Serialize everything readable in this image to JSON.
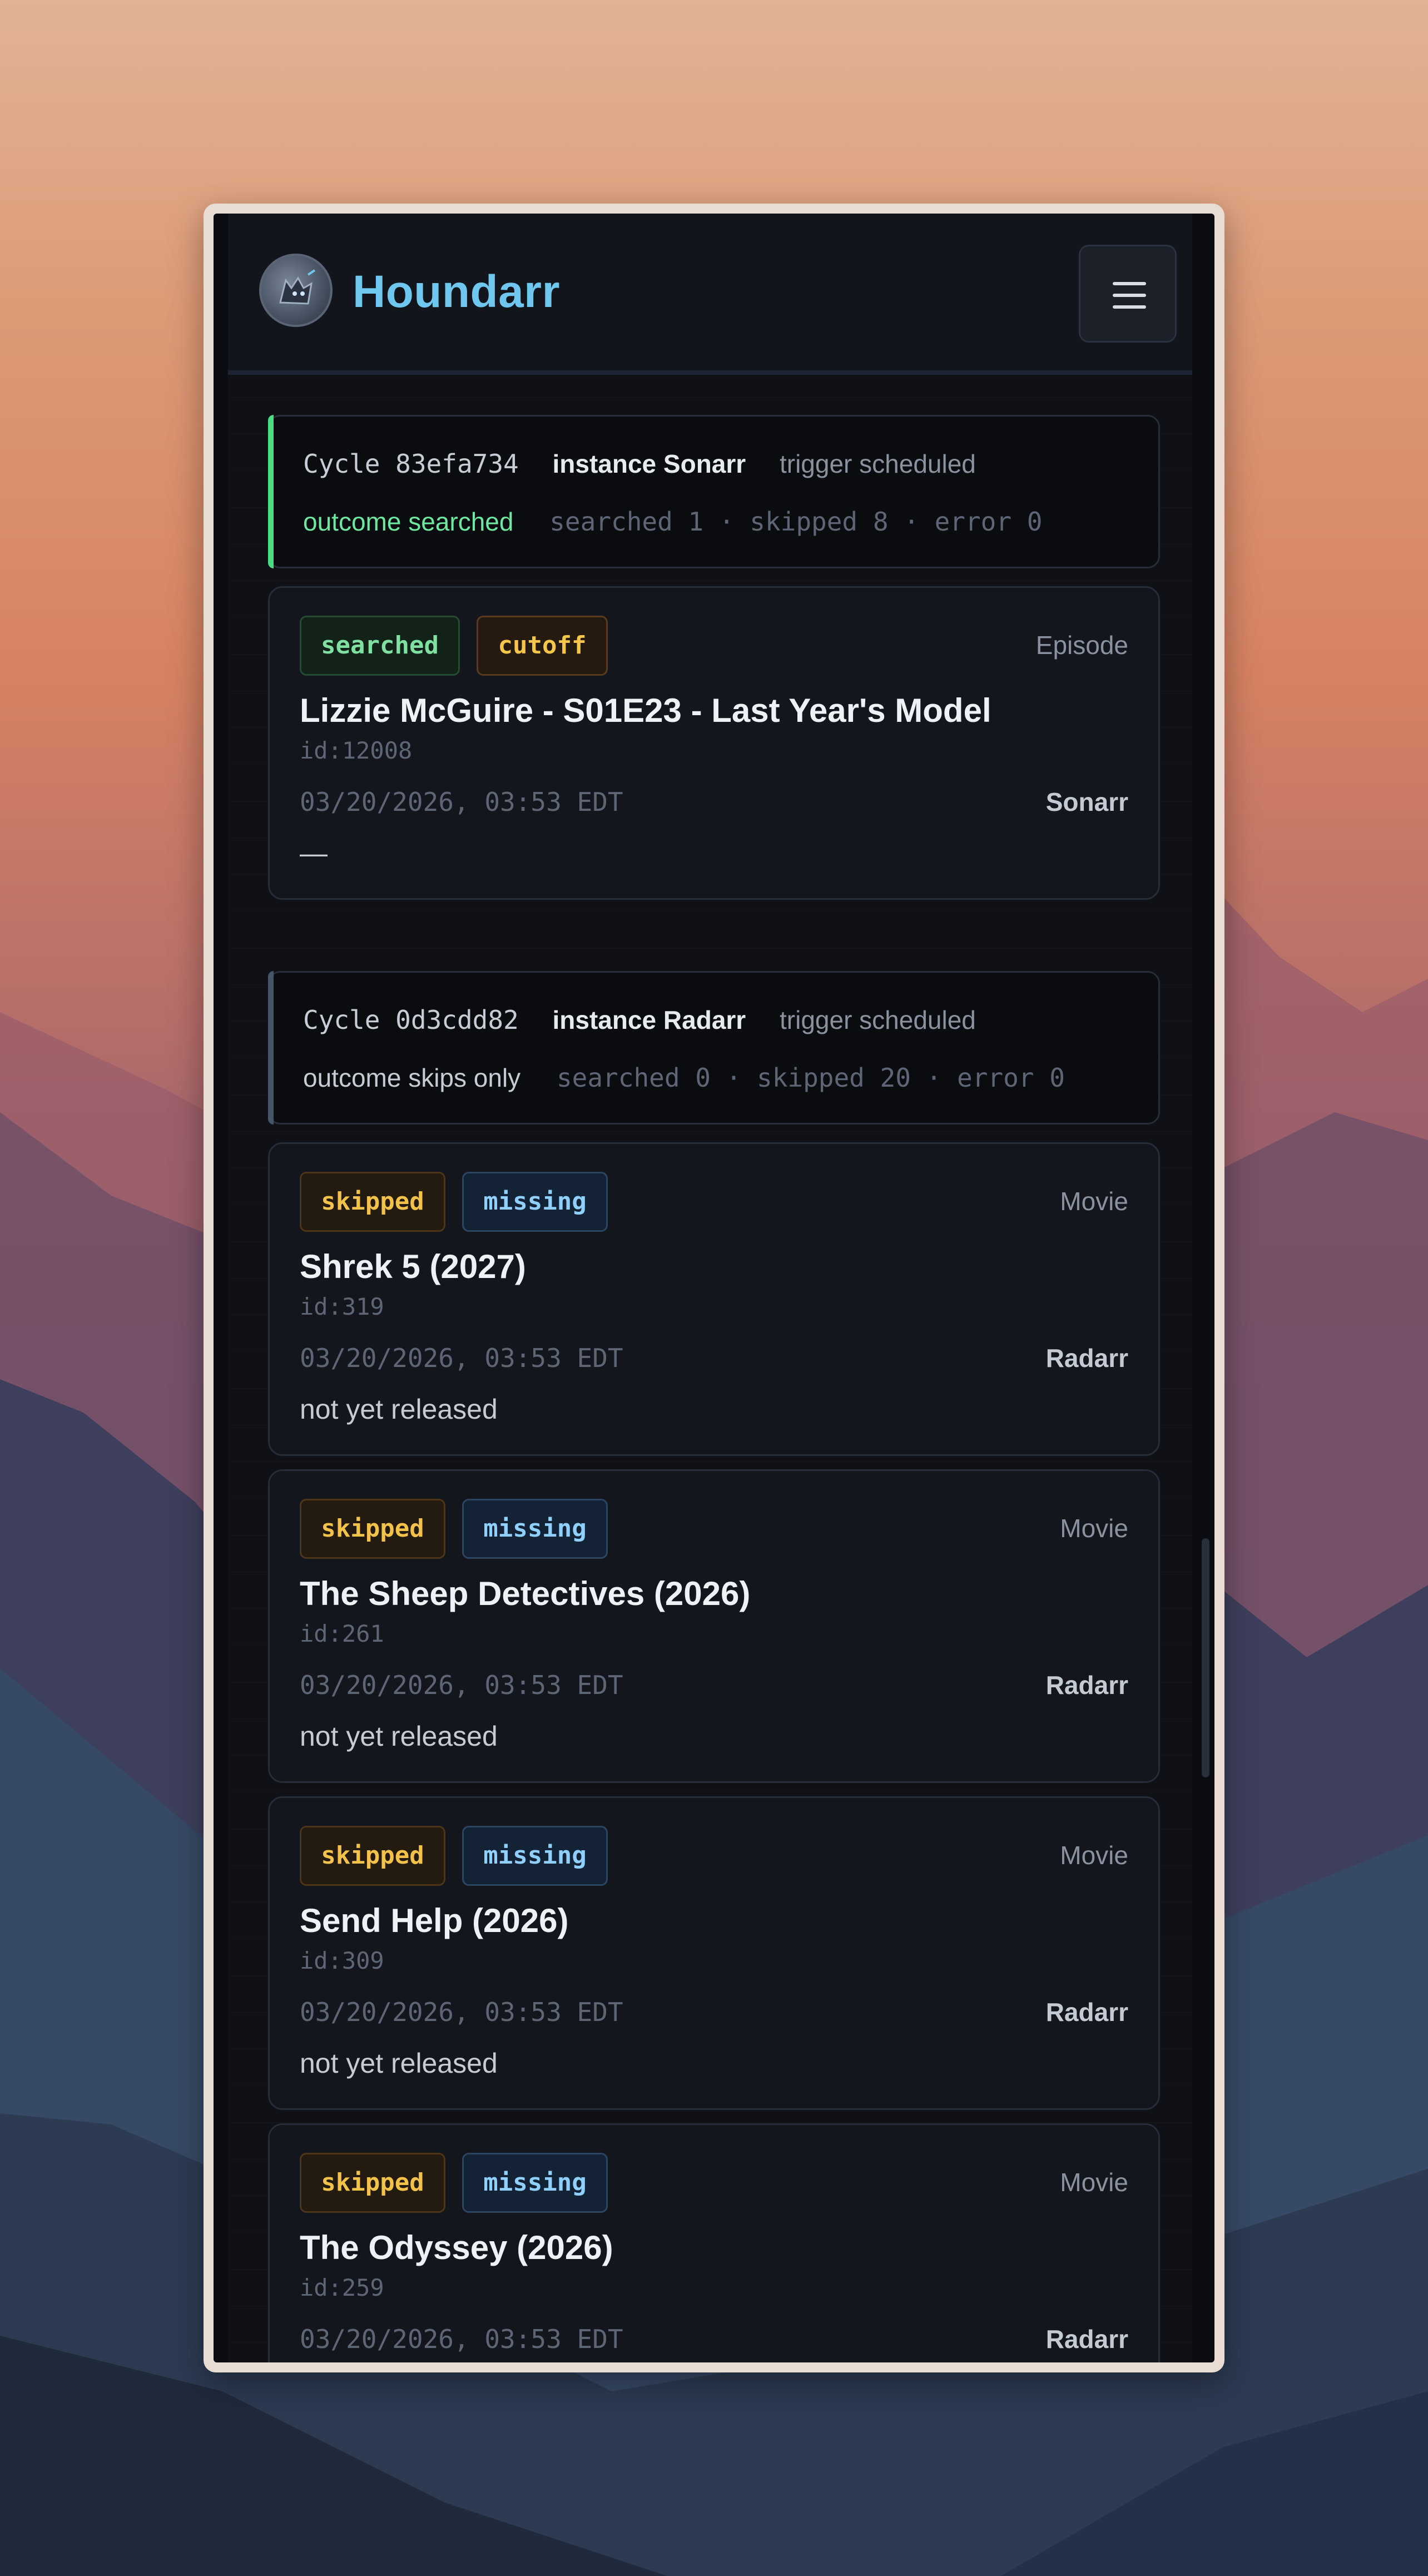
{
  "app": {
    "name": "Houndarr"
  },
  "header": {
    "menu_icon": "hamburger-menu-icon"
  },
  "cycles": [
    {
      "label": "Cycle 83efa734",
      "instance": "instance Sonarr",
      "trigger": "trigger scheduled",
      "outcome": "outcome searched",
      "stats": "searched 1 · skipped 8 · error 0",
      "accent": "#4ade80",
      "outcome_color": "#6ee7a0",
      "items": [
        {
          "badges": [
            "searched",
            "cutoff"
          ],
          "kind": "Episode",
          "title": "Lizzie McGuire - S01E23 - Last Year's Model",
          "id": "id:12008",
          "timestamp": "03/20/2026, 03:53 EDT",
          "instance": "Sonarr",
          "reason": "—"
        }
      ]
    },
    {
      "label": "Cycle 0d3cdd82",
      "instance": "instance Radarr",
      "trigger": "trigger scheduled",
      "outcome": "outcome skips only",
      "stats": "searched 0 · skipped 20 · error 0",
      "accent": "#475569",
      "outcome_color": "#c7ccd4",
      "items": [
        {
          "badges": [
            "skipped",
            "missing"
          ],
          "kind": "Movie",
          "title": "Shrek 5 (2027)",
          "id": "id:319",
          "timestamp": "03/20/2026, 03:53 EDT",
          "instance": "Radarr",
          "reason": "not yet released"
        },
        {
          "badges": [
            "skipped",
            "missing"
          ],
          "kind": "Movie",
          "title": "The Sheep Detectives (2026)",
          "id": "id:261",
          "timestamp": "03/20/2026, 03:53 EDT",
          "instance": "Radarr",
          "reason": "not yet released"
        },
        {
          "badges": [
            "skipped",
            "missing"
          ],
          "kind": "Movie",
          "title": "Send Help (2026)",
          "id": "id:309",
          "timestamp": "03/20/2026, 03:53 EDT",
          "instance": "Radarr",
          "reason": "not yet released"
        },
        {
          "badges": [
            "skipped",
            "missing"
          ],
          "kind": "Movie",
          "title": "The Odyssey (2026)",
          "id": "id:259",
          "timestamp": "03/20/2026, 03:53 EDT",
          "instance": "Radarr",
          "reason": ""
        }
      ]
    }
  ]
}
